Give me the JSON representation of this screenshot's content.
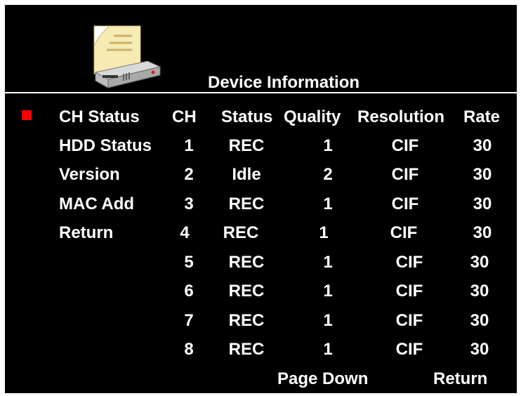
{
  "title": "Device Information",
  "menu": [
    {
      "label": "CH Status",
      "selected": true
    },
    {
      "label": "HDD Status",
      "selected": false
    },
    {
      "label": "Version",
      "selected": false
    },
    {
      "label": "MAC Add",
      "selected": false
    },
    {
      "label": "Return",
      "selected": false
    }
  ],
  "table": {
    "headers": {
      "ch": "CH",
      "status": "Status",
      "quality": "Quality",
      "resolution": "Resolution",
      "rate": "Rate"
    },
    "rows": [
      {
        "ch": "1",
        "status": "REC",
        "quality": "1",
        "resolution": "CIF",
        "rate": "30"
      },
      {
        "ch": "2",
        "status": "Idle",
        "quality": "2",
        "resolution": "CIF",
        "rate": "30"
      },
      {
        "ch": "3",
        "status": "REC",
        "quality": "1",
        "resolution": "CIF",
        "rate": "30"
      },
      {
        "ch": "4",
        "status": "REC",
        "quality": "1",
        "resolution": "CIF",
        "rate": "30"
      },
      {
        "ch": "5",
        "status": "REC",
        "quality": "1",
        "resolution": "CIF",
        "rate": "30"
      },
      {
        "ch": "6",
        "status": "REC",
        "quality": "1",
        "resolution": "CIF",
        "rate": "30"
      },
      {
        "ch": "7",
        "status": "REC",
        "quality": "1",
        "resolution": "CIF",
        "rate": "30"
      },
      {
        "ch": "8",
        "status": "REC",
        "quality": "1",
        "resolution": "CIF",
        "rate": "30"
      }
    ]
  },
  "footer": {
    "page_down": "Page Down",
    "return": "Return"
  },
  "icons": {
    "header": "device-info-icon",
    "selection": "selection-marker-icon"
  },
  "colors": {
    "background": "#000000",
    "text": "#ffffff",
    "marker": "#ff0000"
  }
}
